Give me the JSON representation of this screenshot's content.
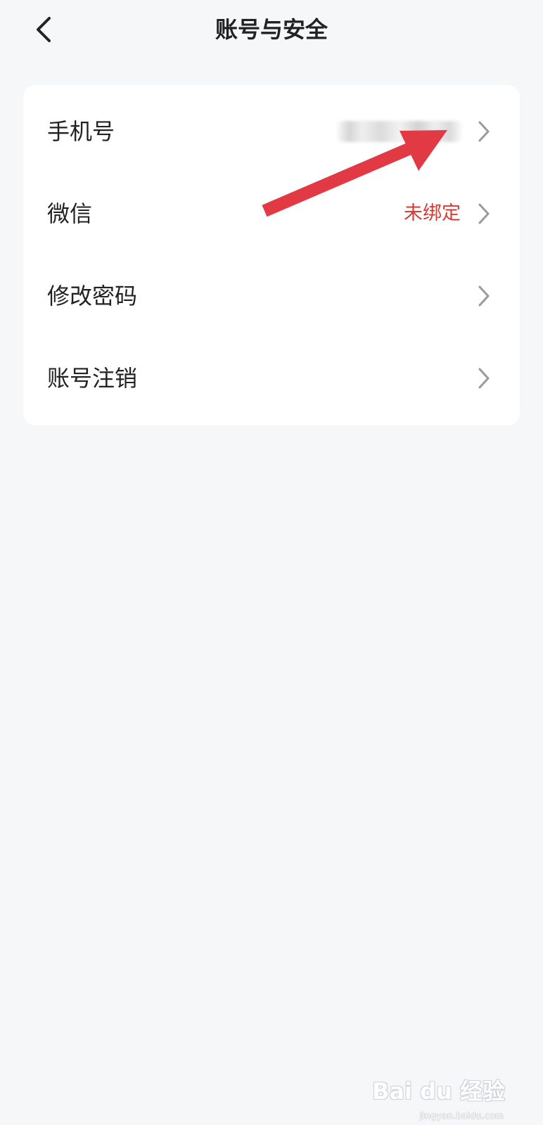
{
  "header": {
    "title": "账号与安全",
    "back_icon": "chevron-left-icon"
  },
  "settings": {
    "items": [
      {
        "label": "手机号",
        "value": "",
        "value_blurred": true,
        "chevron_icon": "chevron-right-icon"
      },
      {
        "label": "微信",
        "value": "未绑定",
        "value_color": "#d63a34",
        "chevron_icon": "chevron-right-icon"
      },
      {
        "label": "修改密码",
        "value": "",
        "chevron_icon": "chevron-right-icon"
      },
      {
        "label": "账号注销",
        "value": "",
        "chevron_icon": "chevron-right-icon"
      }
    ]
  },
  "annotation": {
    "arrow_color": "#e23a44"
  },
  "watermark": {
    "text": "Bai du 经验",
    "sub": "jingyan.baidu.com"
  },
  "colors": {
    "background": "#f6f7f9",
    "card": "#ffffff",
    "text": "#222222",
    "chevron": "#9a9a9a"
  }
}
